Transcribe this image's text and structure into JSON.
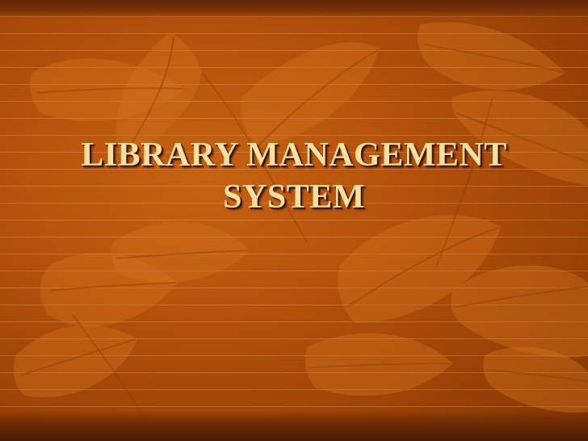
{
  "slide": {
    "title_lines": [
      "LIBRARY MANAGEMENT",
      "SYSTEM"
    ],
    "background": {
      "base_color": "#b5520c",
      "dark_color": "#7e3304",
      "leaf_color": "#d2731c",
      "leaf_vein_color": "#8f3f06",
      "title_color": "#f6dfa0",
      "shadow_color": "#3c1601",
      "decor_icon": "leaf-pattern"
    }
  }
}
